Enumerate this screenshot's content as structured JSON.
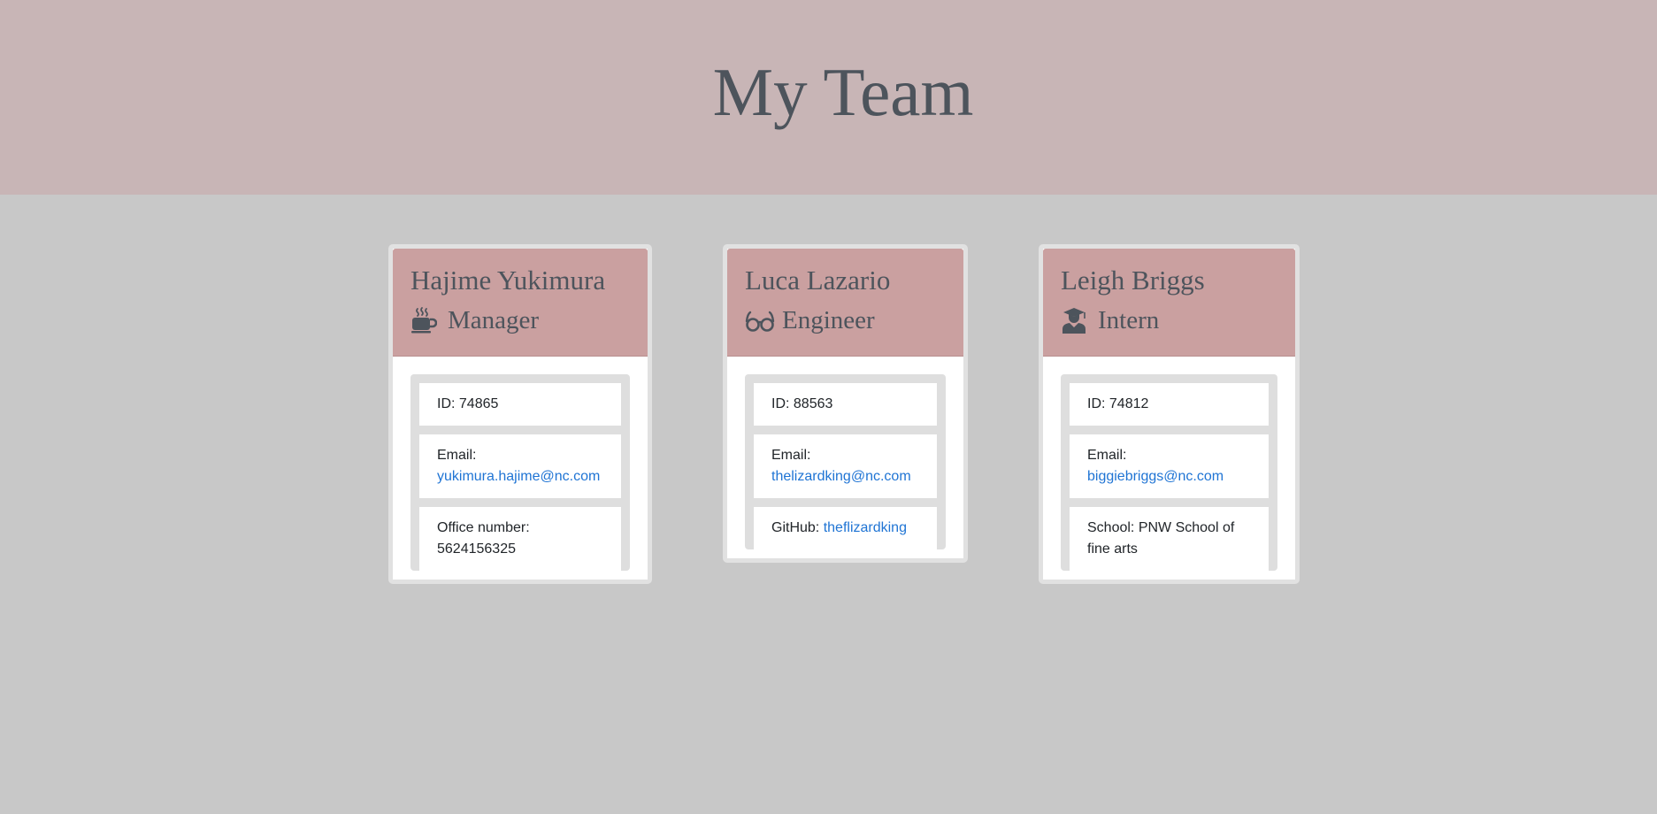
{
  "header": {
    "title": "My Team"
  },
  "colors": {
    "header_bg": "#c8b5b6",
    "page_bg": "#c8c8c8",
    "card_header_bg": "#caa0a0",
    "link": "#1f74d4",
    "title_text": "#4d545c"
  },
  "cards": [
    {
      "name": "Hajime Yukimura",
      "role": "Manager",
      "role_icon": "mug-icon",
      "id_label": "ID: 74865",
      "email_label": "Email:",
      "email": "yukimura.hajime@nc.com",
      "extra_label": "Office number: 5624156325",
      "extra_value": ""
    },
    {
      "name": "Luca Lazario",
      "role": "Engineer",
      "role_icon": "glasses-icon",
      "id_label": "ID: 88563",
      "email_label": "Email:",
      "email": "thelizardking@nc.com",
      "extra_label": "GitHub:",
      "extra_value": "theflizardking"
    },
    {
      "name": "Leigh Briggs",
      "role": "Intern",
      "role_icon": "graduate-icon",
      "id_label": "ID: 74812",
      "email_label": "Email:",
      "email": "biggiebriggs@nc.com",
      "extra_label": "School: PNW School of fine arts",
      "extra_value": ""
    }
  ]
}
